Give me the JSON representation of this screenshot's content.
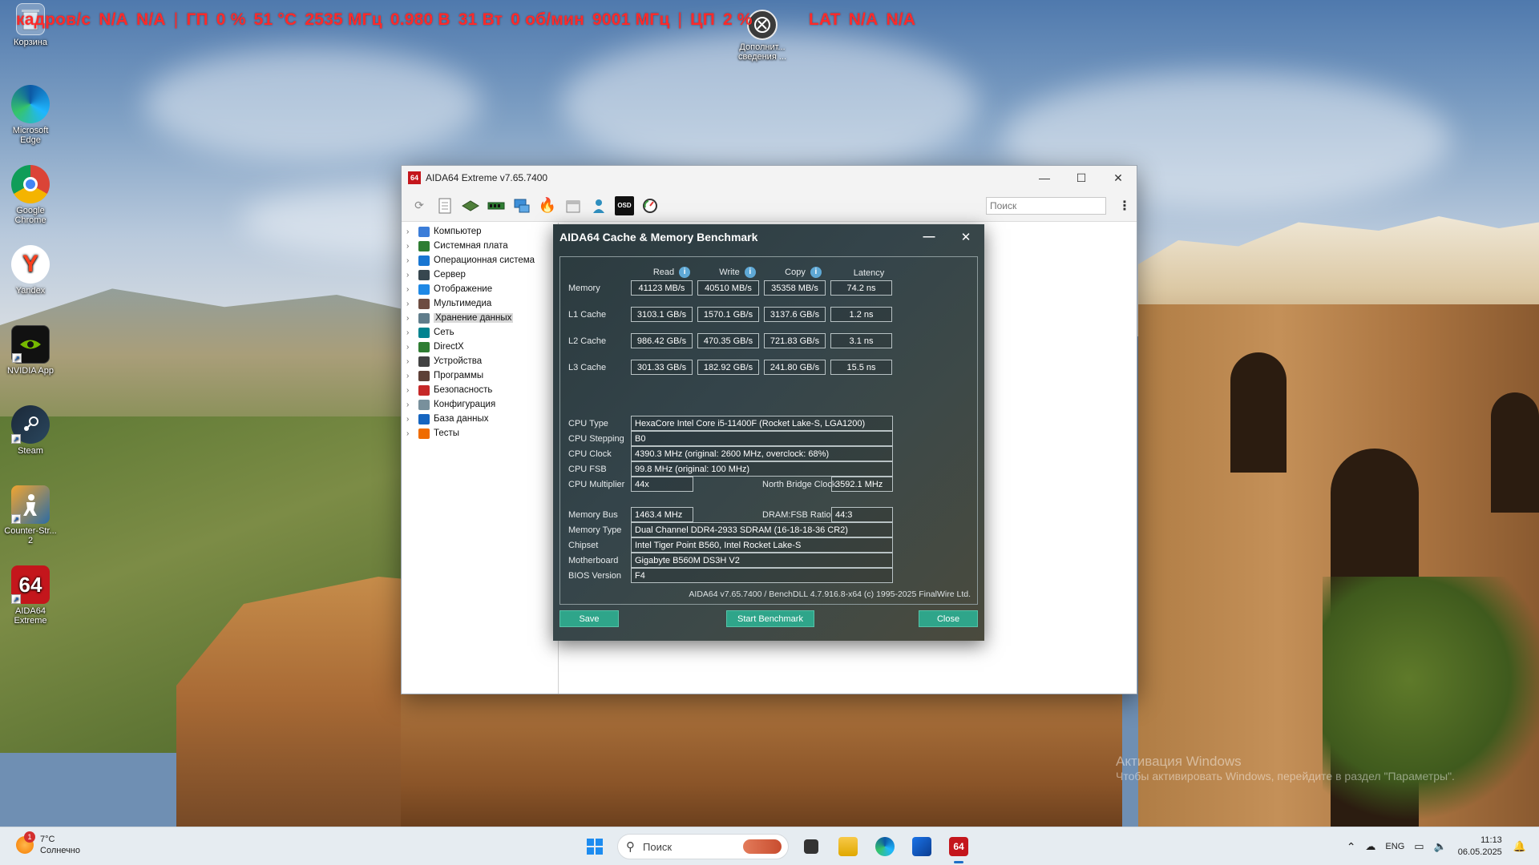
{
  "osd": {
    "fps_label": "кадров/с",
    "fps_val1": "N/A",
    "fps_val2": "N/A",
    "sep": "|",
    "gpu_label": "ГП",
    "gpu_load": "0 %",
    "gpu_temp": "51 °C",
    "gpu_clock": "2535 МГц",
    "gpu_volt": "0.980 В",
    "gpu_power": "31 Вт",
    "gpu_fan": "0 об/мин",
    "gpu_mem_clock": "9001 МГц",
    "cpu_label": "ЦП",
    "cpu_load": "2 %",
    "lat_label": "LAT",
    "lat_val1": "N/A",
    "lat_val2": "N/A"
  },
  "desktop": {
    "icons": [
      {
        "label": "Корзина",
        "icon": "recycle-bin-icon"
      },
      {
        "label": "Microsoft Edge",
        "icon": "edge-icon"
      },
      {
        "label": "Google Chrome",
        "icon": "chrome-icon"
      },
      {
        "label": "Yandex",
        "icon": "yandex-icon",
        "glyph": "Y"
      },
      {
        "label": "NVIDIA App",
        "icon": "nvidia-icon"
      },
      {
        "label": "Steam",
        "icon": "steam-icon"
      },
      {
        "label": "Counter-Str... 2",
        "icon": "counter-strike-icon"
      },
      {
        "label": "AIDA64 Extreme",
        "icon": "aida64-icon",
        "glyph": "64"
      }
    ],
    "extra_icon": {
      "label": "Дополнит... сведения ...",
      "icon": "additional-info-icon"
    },
    "watermark_title": "Активация Windows",
    "watermark_sub": "Чтобы активировать Windows, перейдите в раздел \"Параметры\"."
  },
  "aida": {
    "title": "AIDA64 Extreme v7.65.7400",
    "logo": "64",
    "search_placeholder": "Поиск",
    "toolbar_osd": "OSD",
    "tree": [
      {
        "label": "Компьютер",
        "color": "#3b7dd8"
      },
      {
        "label": "Системная плата",
        "color": "#2e7d32"
      },
      {
        "label": "Операционная система",
        "color": "#1976d2"
      },
      {
        "label": "Сервер",
        "color": "#37474f"
      },
      {
        "label": "Отображение",
        "color": "#1e88e5"
      },
      {
        "label": "Мультимедиа",
        "color": "#6d4c41"
      },
      {
        "label": "Хранение данных",
        "color": "#607d8b"
      },
      {
        "label": "Сеть",
        "color": "#00838f"
      },
      {
        "label": "DirectX",
        "color": "#2e7d32"
      },
      {
        "label": "Устройства",
        "color": "#424242"
      },
      {
        "label": "Программы",
        "color": "#5d4037"
      },
      {
        "label": "Безопасность",
        "color": "#c62828"
      },
      {
        "label": "Конфигурация",
        "color": "#78909c"
      },
      {
        "label": "База данных",
        "color": "#1565c0"
      },
      {
        "label": "Тесты",
        "color": "#ef6c00"
      }
    ],
    "selected_tree_index": 6
  },
  "bench": {
    "title": "AIDA64 Cache & Memory Benchmark",
    "headers": {
      "read": "Read",
      "write": "Write",
      "copy": "Copy",
      "latency": "Latency"
    },
    "rows": [
      {
        "label": "Memory",
        "read": "41123 MB/s",
        "write": "40510 MB/s",
        "copy": "35358 MB/s",
        "latency": "74.2 ns"
      },
      {
        "label": "L1 Cache",
        "read": "3103.1 GB/s",
        "write": "1570.1 GB/s",
        "copy": "3137.6 GB/s",
        "latency": "1.2 ns"
      },
      {
        "label": "L2 Cache",
        "read": "986.42 GB/s",
        "write": "470.35 GB/s",
        "copy": "721.83 GB/s",
        "latency": "3.1 ns"
      },
      {
        "label": "L3 Cache",
        "read": "301.33 GB/s",
        "write": "182.92 GB/s",
        "copy": "241.80 GB/s",
        "latency": "15.5 ns"
      }
    ],
    "cpu": {
      "type_label": "CPU Type",
      "type": "HexaCore Intel Core i5-11400F  (Rocket Lake-S, LGA1200)",
      "stepping_label": "CPU Stepping",
      "stepping": "B0",
      "clock_label": "CPU Clock",
      "clock": "4390.3 MHz  (original: 2600 MHz, overclock: 68%)",
      "fsb_label": "CPU FSB",
      "fsb": "99.8 MHz  (original: 100 MHz)",
      "mult_label": "CPU Multiplier",
      "mult": "44x",
      "nb_label": "North Bridge Clock",
      "nb": "3592.1 MHz"
    },
    "mem": {
      "bus_label": "Memory Bus",
      "bus": "1463.4 MHz",
      "ratio_label": "DRAM:FSB Ratio",
      "ratio": "44:3",
      "type_label": "Memory Type",
      "type": "Dual Channel DDR4-2933 SDRAM  (16-18-18-36 CR2)",
      "chipset_label": "Chipset",
      "chipset": "Intel Tiger Point B560, Intel Rocket Lake-S",
      "mb_label": "Motherboard",
      "mb": "Gigabyte B560M DS3H V2",
      "bios_label": "BIOS Version",
      "bios": "F4"
    },
    "footer": "AIDA64 v7.65.7400 / BenchDLL 4.7.916.8-x64  (c) 1995-2025 FinalWire Ltd.",
    "buttons": {
      "save": "Save",
      "start": "Start Benchmark",
      "close": "Close"
    }
  },
  "taskbar": {
    "weather_temp": "7°C",
    "weather_desc": "Солнечно",
    "weather_badge": "1",
    "search_placeholder": "Поиск",
    "lang": "ENG",
    "time": "11:13",
    "date": "06.05.2025",
    "aida_glyph": "64"
  }
}
